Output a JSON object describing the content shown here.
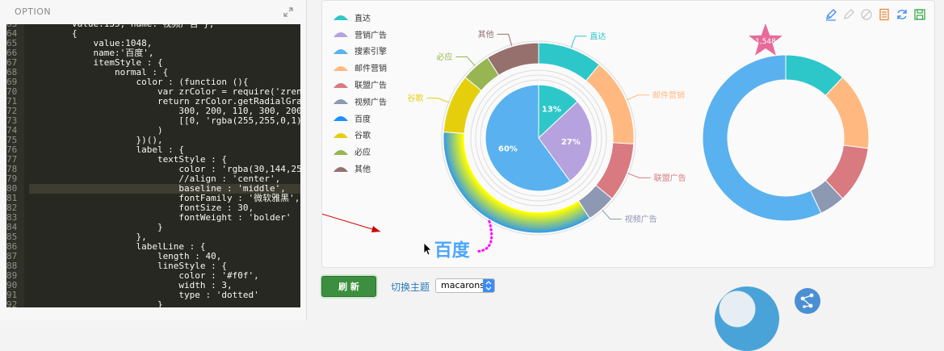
{
  "code_panel": {
    "title": "OPTION",
    "line_numbers": [
      "63",
      "64",
      "65",
      "66",
      "67",
      "68",
      "69",
      "70",
      "71",
      "72",
      "73",
      "74",
      "75",
      "76",
      "77",
      "78",
      "79",
      "80",
      "81",
      "82",
      "83",
      "84",
      "85",
      "86",
      "87",
      "88",
      "89",
      "90",
      "91",
      "92"
    ],
    "lines": [
      "        value:135, name:'视频广告'},",
      "        {",
      "            value:1048,",
      "            name:'百度',",
      "            itemStyle : {",
      "                normal : {",
      "                    color : (function (){",
      "                        var zrColor = require('zrender/tool/color');",
      "                        return zrColor.getRadialGradient(",
      "                            300, 200, 110, 300, 200, 140,",
      "                            [[0, 'rgba(255,255,0,1)'],[1, 'rgba(30,144,25",
      "                        )",
      "                    })(),",
      "                    label : {",
      "                        textStyle : {",
      "                            color : 'rgba(30,144,255,0.8)',",
      "                            //align : 'center',",
      "                            baseline : 'middle',",
      "                            fontFamily : '微软雅黑',",
      "                            fontSize : 30,",
      "                            fontWeight : 'bolder'",
      "                        }",
      "                    },",
      "                    labelLine : {",
      "                        length : 40,",
      "                        lineStyle : {",
      "                            color : '#f0f',",
      "                            width : 3,",
      "                            type : 'dotted'",
      "                        }"
    ]
  },
  "toolbox": [
    "mark-icon",
    "mark-undo-icon",
    "mark-clear-icon",
    "data-view-icon",
    "restore-icon",
    "save-image-icon"
  ],
  "controls": {
    "refresh_label": "刷 新",
    "theme_label": "切换主题",
    "theme_value": "macarons"
  },
  "chart_data": {
    "type": "pie",
    "legend": [
      "直达",
      "营销广告",
      "搜索引擎",
      "邮件营销",
      "联盟广告",
      "视频广告",
      "百度",
      "谷歌",
      "必应",
      "其他"
    ],
    "legend_colors": [
      "#2ec7c9",
      "#b6a2de",
      "#5ab1ef",
      "#ffb980",
      "#d87a80",
      "#8d98b3",
      "#1e90ff",
      "#e5cf0d",
      "#97b552",
      "#95706d"
    ],
    "inner_pie": {
      "labels": [
        "直达",
        "营销广告",
        "搜索引擎"
      ],
      "percent_labels": [
        "13%",
        "27%",
        "60%"
      ],
      "share": [
        13,
        27,
        60
      ],
      "colors": [
        "#2ec7c9",
        "#b6a2de",
        "#5ab1ef"
      ]
    },
    "outer_ring": {
      "labels": [
        "直达",
        "邮件营销",
        "联盟广告",
        "视频广告",
        "百度",
        "谷歌",
        "必应",
        "其他"
      ],
      "share": [
        11,
        15,
        10,
        5,
        35,
        10,
        5,
        9
      ],
      "colors": [
        "#2ec7c9",
        "#ffb980",
        "#d87a80",
        "#8d98b3",
        "#1e90ff",
        "#e5cf0d",
        "#97b552",
        "#95706d"
      ],
      "emphasis_label": "百度",
      "label_line_style": "dotted",
      "label_line_color": "#f0f"
    },
    "right_ring": {
      "share": [
        12,
        15,
        11,
        5,
        57
      ],
      "colors": [
        "#2ec7c9",
        "#ffb980",
        "#d87a80",
        "#8d98b3",
        "#5ab1ef"
      ],
      "mark_point_value": "1,548",
      "mark_point_color": "#e76a9b"
    }
  }
}
